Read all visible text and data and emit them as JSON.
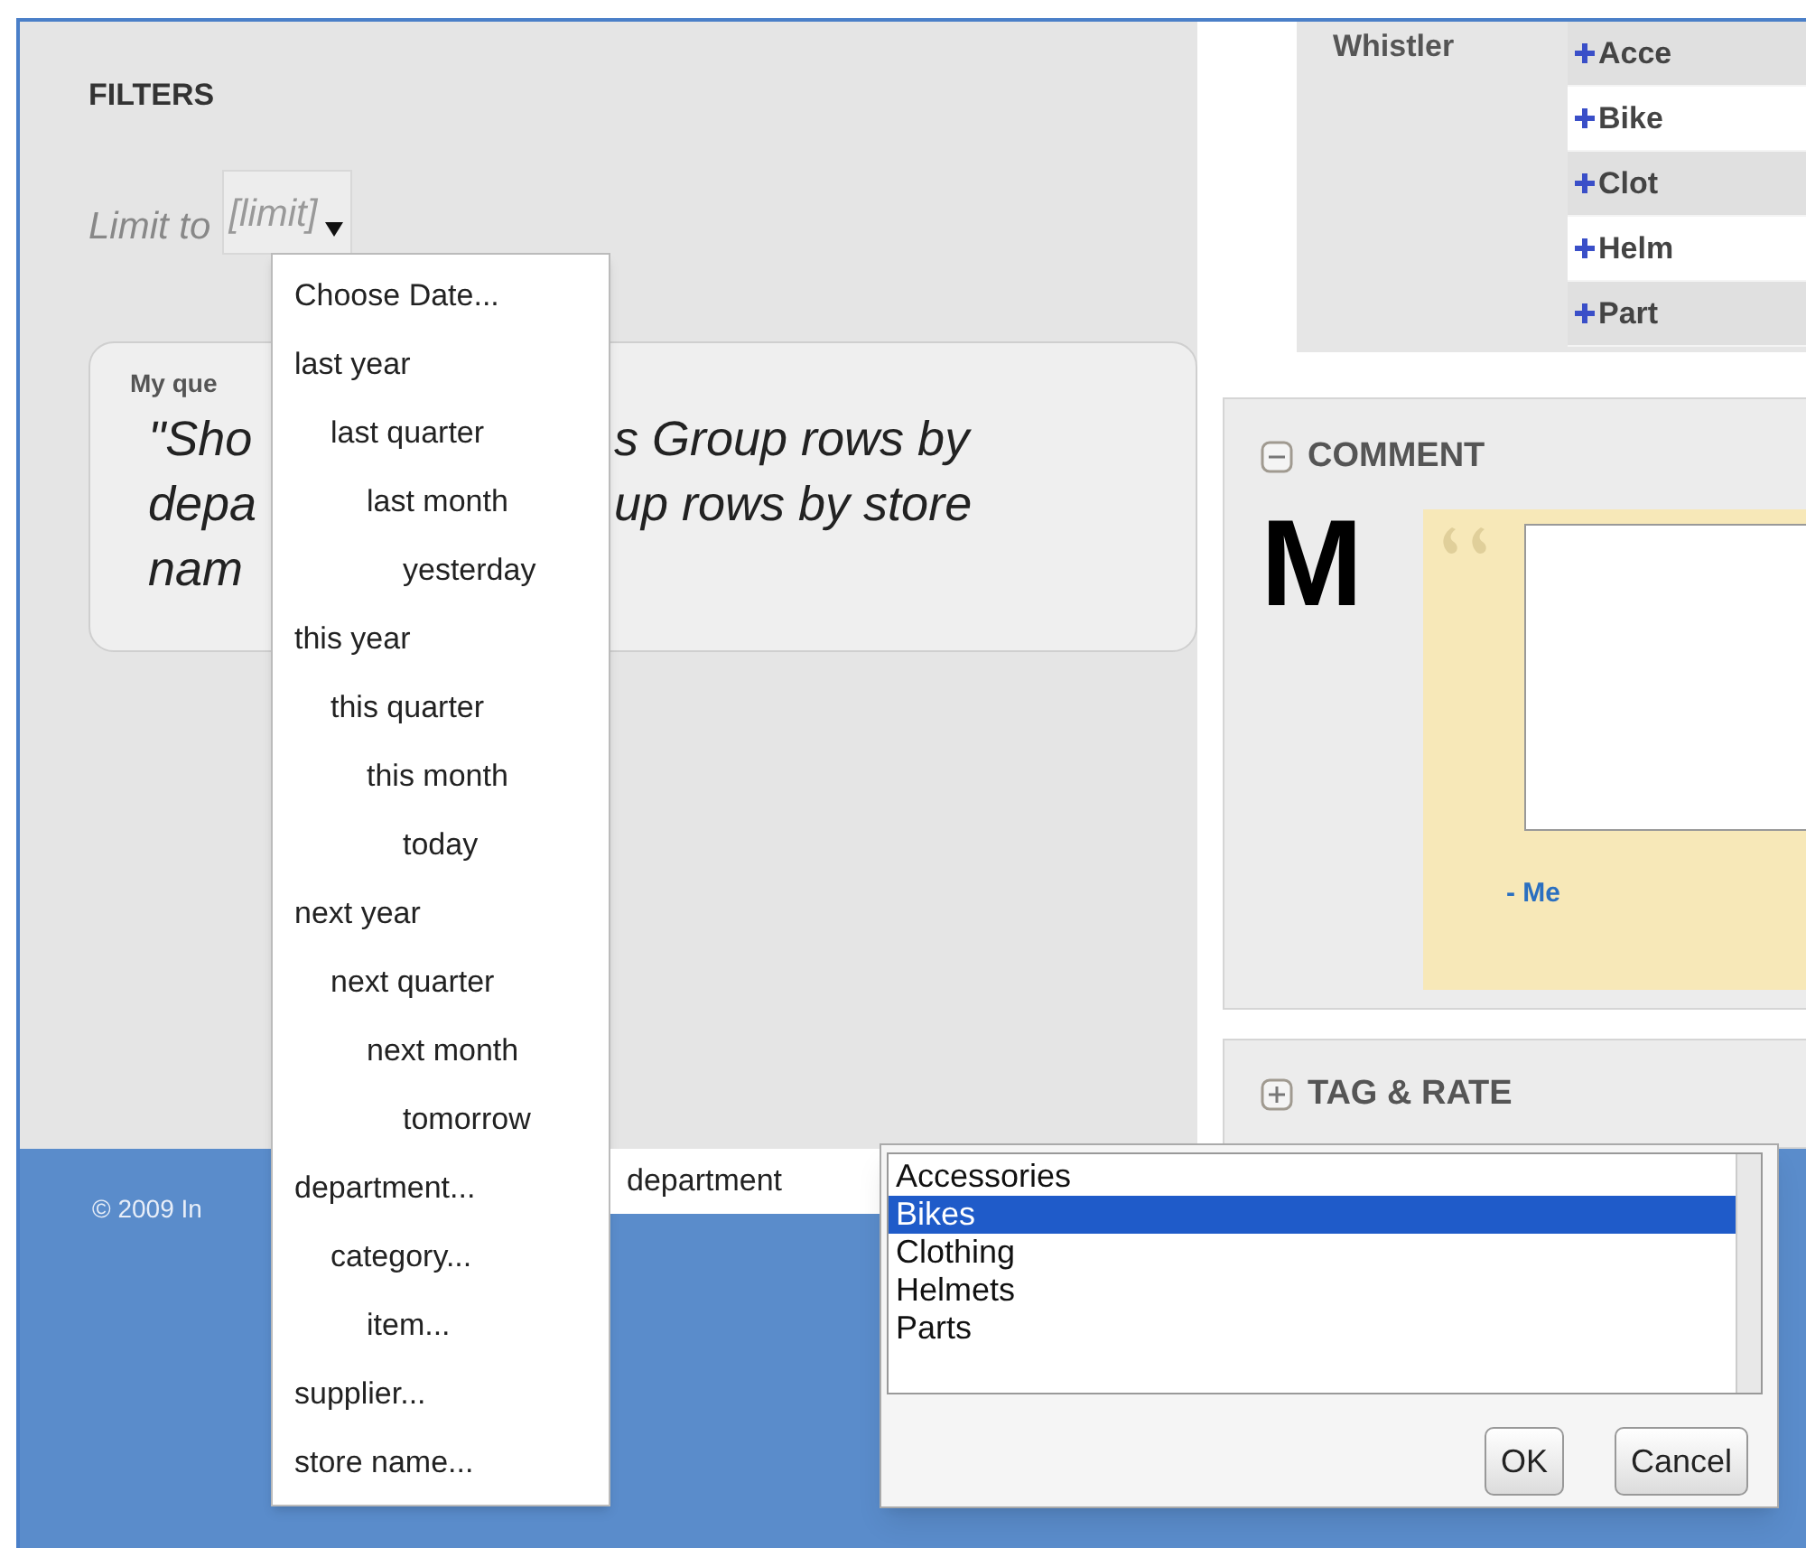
{
  "filters": {
    "title": "FILTERS",
    "limit_label": "Limit to",
    "limit_value": "[limit]"
  },
  "query": {
    "label": "My que",
    "lines": [
      {
        "left": "\"Sho",
        "right": "s Group rows by"
      },
      {
        "left": "depa",
        "right": "up rows by store"
      },
      {
        "left": "nam"
      }
    ]
  },
  "date_menu": {
    "items": [
      {
        "label": "Choose Date..."
      },
      {
        "label": "last year",
        "children": [
          {
            "label": "last quarter",
            "children": [
              {
                "label": "last month",
                "children": [
                  {
                    "label": "yesterday"
                  }
                ]
              }
            ]
          }
        ]
      },
      {
        "label": "this year",
        "children": [
          {
            "label": "this quarter",
            "children": [
              {
                "label": "this month",
                "children": [
                  {
                    "label": "today"
                  }
                ]
              }
            ]
          }
        ]
      },
      {
        "label": "next year",
        "children": [
          {
            "label": "next quarter",
            "children": [
              {
                "label": "next month",
                "children": [
                  {
                    "label": "tomorrow"
                  }
                ]
              }
            ]
          }
        ]
      },
      {
        "label": "department...",
        "children": [
          {
            "label": "category...",
            "children": [
              {
                "label": "item..."
              }
            ]
          }
        ]
      },
      {
        "label": "supplier..."
      },
      {
        "label": "store name..."
      }
    ]
  },
  "submenu": {
    "label": "department"
  },
  "listbox": {
    "options": [
      {
        "label": "Accessories",
        "selected": false
      },
      {
        "label": "Bikes",
        "selected": true
      },
      {
        "label": "Clothing",
        "selected": false
      },
      {
        "label": "Helmets",
        "selected": false
      },
      {
        "label": "Parts",
        "selected": false
      }
    ],
    "buttons": [
      "OK",
      "Cancel"
    ]
  },
  "store_table": {
    "store": "Whistler",
    "items": [
      "Acce",
      "Bike",
      "Clot",
      "Helm",
      "Part"
    ]
  },
  "comment": {
    "title": "COMMENT",
    "expanded": true,
    "avatar": "M",
    "author": "- Me"
  },
  "tag_rate": {
    "title": "TAG & RATE",
    "expanded": false
  },
  "footer": {
    "copyright": "© 2009 In"
  }
}
